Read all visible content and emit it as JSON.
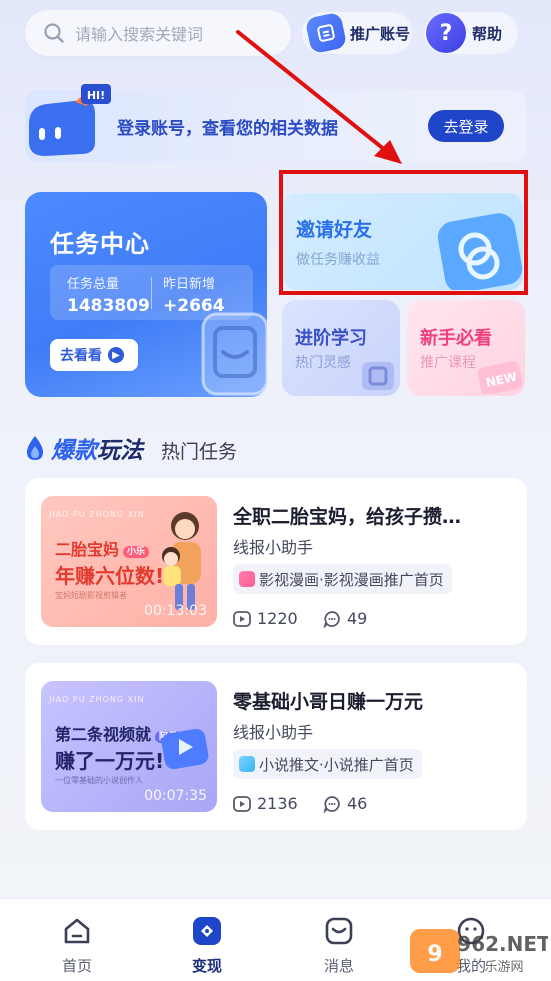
{
  "search": {
    "placeholder": "请输入搜索关键词"
  },
  "header": {
    "promo_label": "推广账号",
    "help_label": "帮助"
  },
  "login_banner": {
    "badge": "HI!",
    "text": "登录账号，查看您的相关数据",
    "button": "去登录"
  },
  "task_center": {
    "title": "任务中心",
    "stats": [
      {
        "label": "任务总量",
        "value": "1483809"
      },
      {
        "label": "昨日新增",
        "value": "+2664"
      }
    ],
    "button": "去看看"
  },
  "invite": {
    "title": "邀请好友",
    "subtitle": "做任务赚收益"
  },
  "learn": {
    "title": "进阶学习",
    "subtitle": "热门灵感"
  },
  "newbie": {
    "title": "新手必看",
    "subtitle": "推广课程",
    "badge": "NEW"
  },
  "section": {
    "title_highlight": "爆款",
    "title_rest": "玩法",
    "tab": "热门任务"
  },
  "tasks": [
    {
      "thumb_small": "JIAO PU ZHONG XIN",
      "thumb_line1": "二胎宝妈",
      "thumb_tag": "小乐",
      "thumb_line2": "年赚六位数!",
      "thumb_line3": "宝妈短剧影视剪辑者",
      "duration": "00:13:03",
      "title": "全职二胎宝妈，给孩子攒…",
      "author": "线报小助手",
      "category": "影视漫画·影视漫画推广首页",
      "views": "1220",
      "comments": "49"
    },
    {
      "thumb_small": "JIAO PU ZHONG XIN",
      "thumb_line1": "第二条视频就",
      "thumb_tag": "阿泽",
      "thumb_line2": "赚了一万元!",
      "thumb_line3": "一位零基础的小说创作人",
      "duration": "00:07:35",
      "title": "零基础小哥日赚一万元",
      "author": "线报小助手",
      "category": "小说推文·小说推广首页",
      "views": "2136",
      "comments": "46"
    }
  ],
  "nav": {
    "home": "首页",
    "earn": "变现",
    "message": "消息",
    "me": "我的"
  },
  "watermark": {
    "brand": "962.NET",
    "sub": "乐游网"
  },
  "colors": {
    "accent": "#2d62f0",
    "annotation": "#e01010",
    "login_button": "#1f45c8",
    "pink": "#f0407e"
  }
}
